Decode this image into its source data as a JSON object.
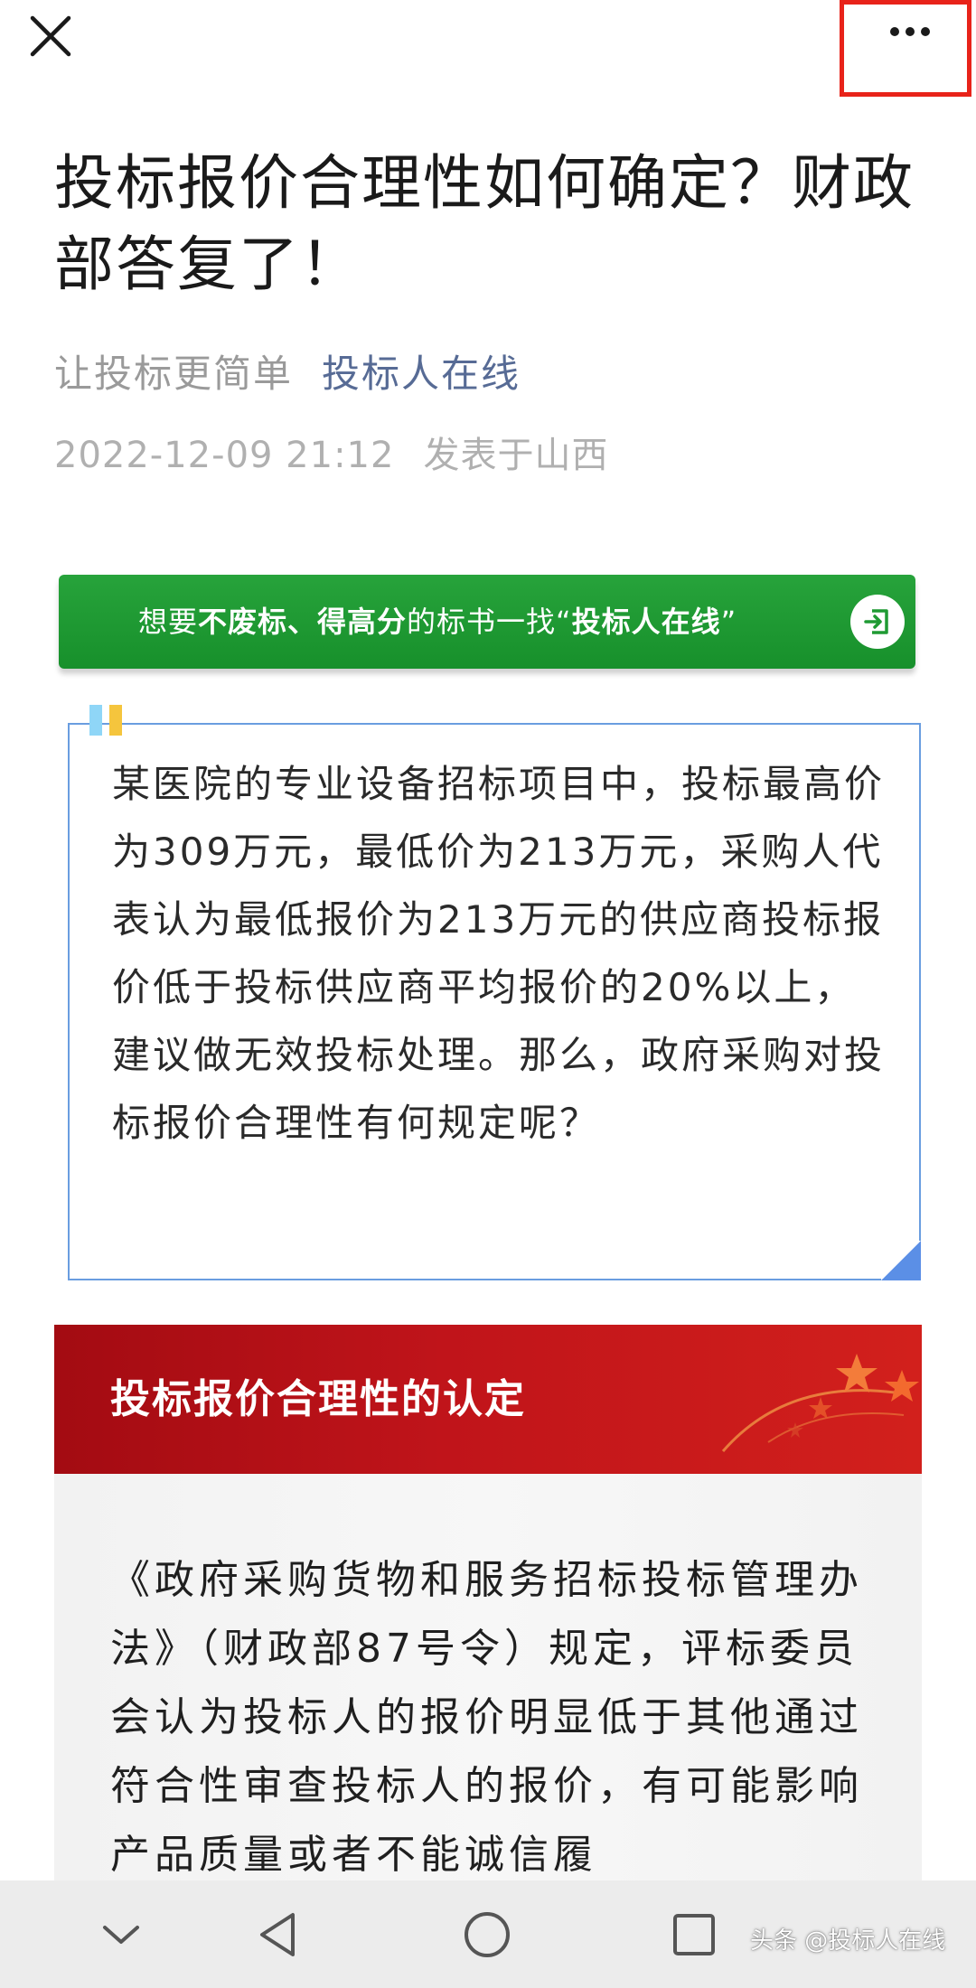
{
  "header": {
    "close_icon": "close-icon",
    "more_icon": "more-dots-icon",
    "highlight_color": "#e8231a"
  },
  "article": {
    "title": "投标报价合理性如何确定？财政部答复了！",
    "author": "让投标更简单",
    "account_name": "投标人在线",
    "date": "2022-12-09 21:12",
    "location": "发表于山西"
  },
  "promo_banner": {
    "text_1": "想要",
    "text_bold_1": "不废标、得高分",
    "text_2": "的标书一找“",
    "text_bold_2": "投标人在线",
    "text_3": "”",
    "icon": "enter-arrow-icon",
    "color": "#1f9a33"
  },
  "quote": {
    "text": "某医院的专业设备招标项目中，投标最高价为309万元，最低价为213万元，采购人代表认为最低报价为213万元的供应商投标报价低于投标供应商平均报价的20%以上，建议做无效投标处理。那么，政府采购对投标报价合理性有何规定呢？",
    "border_color": "#6a9de0"
  },
  "section": {
    "title": "投标报价合理性的认定",
    "color": "#c0141a"
  },
  "body": {
    "text": "《政府采购货物和服务招标投标管理办法》（财政部87号令）规定，评标委员会认为投标人的报价明显低于其他通过符合性审查投标人的报价，有可能影响产品质量或者不能诚信履"
  },
  "nav_bar": {
    "icons": [
      "chevron-down-icon",
      "back-triangle-icon",
      "home-circle-icon",
      "recents-square-icon"
    ]
  },
  "watermark": {
    "text": "头条 @投标人在线"
  }
}
